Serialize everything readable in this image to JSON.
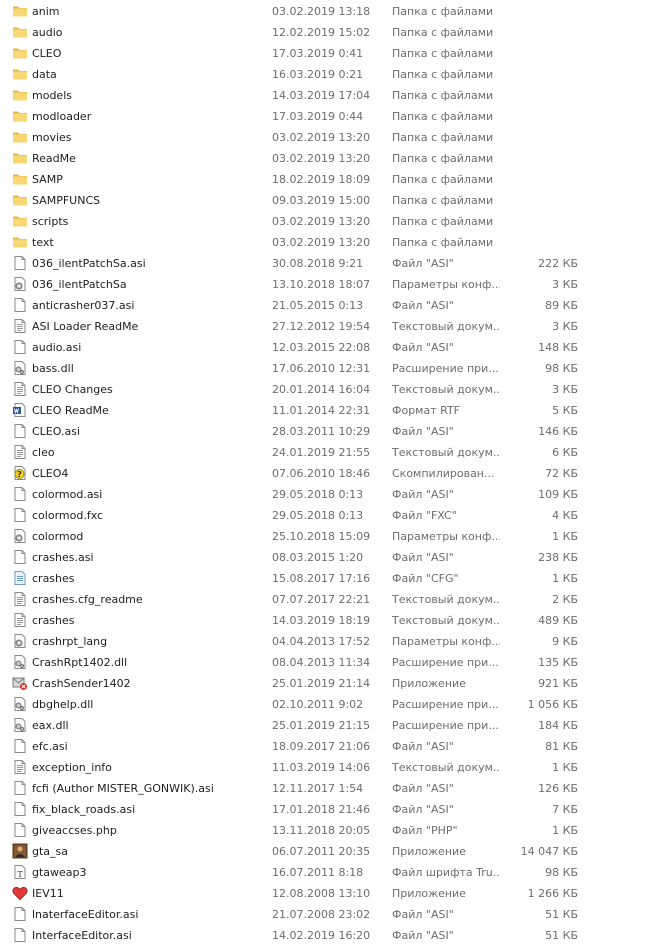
{
  "files": [
    {
      "name": "anim",
      "date": "03.02.2019 13:18",
      "type": "Папка с файлами",
      "size": "",
      "icon": "folder-icon"
    },
    {
      "name": "audio",
      "date": "12.02.2019 15:02",
      "type": "Папка с файлами",
      "size": "",
      "icon": "folder-icon"
    },
    {
      "name": "CLEO",
      "date": "17.03.2019 0:41",
      "type": "Папка с файлами",
      "size": "",
      "icon": "folder-icon"
    },
    {
      "name": "data",
      "date": "16.03.2019 0:21",
      "type": "Папка с файлами",
      "size": "",
      "icon": "folder-icon"
    },
    {
      "name": "models",
      "date": "14.03.2019 17:04",
      "type": "Папка с файлами",
      "size": "",
      "icon": "folder-icon"
    },
    {
      "name": "modloader",
      "date": "17.03.2019 0:44",
      "type": "Папка с файлами",
      "size": "",
      "icon": "folder-icon"
    },
    {
      "name": "movies",
      "date": "03.02.2019 13:20",
      "type": "Папка с файлами",
      "size": "",
      "icon": "folder-icon"
    },
    {
      "name": "ReadMe",
      "date": "03.02.2019 13:20",
      "type": "Папка с файлами",
      "size": "",
      "icon": "folder-icon"
    },
    {
      "name": "SAMP",
      "date": "18.02.2019 18:09",
      "type": "Папка с файлами",
      "size": "",
      "icon": "folder-icon"
    },
    {
      "name": "SAMPFUNCS",
      "date": "09.03.2019 15:00",
      "type": "Папка с файлами",
      "size": "",
      "icon": "folder-icon"
    },
    {
      "name": "scripts",
      "date": "03.02.2019 13:20",
      "type": "Папка с файлами",
      "size": "",
      "icon": "folder-icon"
    },
    {
      "name": "text",
      "date": "03.02.2019 13:20",
      "type": "Папка с файлами",
      "size": "",
      "icon": "folder-icon"
    },
    {
      "name": "036_ilentPatchSa.asi",
      "date": "30.08.2018 9:21",
      "type": "Файл \"ASI\"",
      "size": "222 КБ",
      "icon": "file-icon"
    },
    {
      "name": "036_ilentPatchSa",
      "date": "13.10.2018 18:07",
      "type": "Параметры конф...",
      "size": "3 КБ",
      "icon": "settings-file-icon"
    },
    {
      "name": "anticrasher037.asi",
      "date": "21.05.2015 0:13",
      "type": "Файл \"ASI\"",
      "size": "89 КБ",
      "icon": "file-icon"
    },
    {
      "name": "ASI Loader ReadMe",
      "date": "27.12.2012 19:54",
      "type": "Текстовый докум...",
      "size": "3 КБ",
      "icon": "text-file-icon"
    },
    {
      "name": "audio.asi",
      "date": "12.03.2015 22:08",
      "type": "Файл \"ASI\"",
      "size": "148 КБ",
      "icon": "file-icon"
    },
    {
      "name": "bass.dll",
      "date": "17.06.2010 12:31",
      "type": "Расширение при...",
      "size": "98 КБ",
      "icon": "dll-file-icon"
    },
    {
      "name": "CLEO Changes",
      "date": "20.01.2014 16:04",
      "type": "Текстовый докум...",
      "size": "3 КБ",
      "icon": "text-file-icon"
    },
    {
      "name": "CLEO ReadMe",
      "date": "11.01.2014 22:31",
      "type": "Формат RTF",
      "size": "5 КБ",
      "icon": "rtf-file-icon"
    },
    {
      "name": "CLEO.asi",
      "date": "28.03.2011 10:29",
      "type": "Файл \"ASI\"",
      "size": "146 КБ",
      "icon": "file-icon"
    },
    {
      "name": "cleo",
      "date": "24.01.2019 21:55",
      "type": "Текстовый докум...",
      "size": "6 КБ",
      "icon": "text-file-icon"
    },
    {
      "name": "CLEO4",
      "date": "07.06.2010 18:46",
      "type": "Скомпилирован...",
      "size": "72 КБ",
      "icon": "help-file-icon"
    },
    {
      "name": "colormod.asi",
      "date": "29.05.2018 0:13",
      "type": "Файл \"ASI\"",
      "size": "109 КБ",
      "icon": "file-icon"
    },
    {
      "name": "colormod.fxc",
      "date": "29.05.2018 0:13",
      "type": "Файл \"FXC\"",
      "size": "4 КБ",
      "icon": "file-icon"
    },
    {
      "name": "colormod",
      "date": "25.10.2018 15:09",
      "type": "Параметры конф...",
      "size": "1 КБ",
      "icon": "settings-file-icon"
    },
    {
      "name": "crashes.asi",
      "date": "08.03.2015 1:20",
      "type": "Файл \"ASI\"",
      "size": "238 КБ",
      "icon": "file-icon"
    },
    {
      "name": "crashes",
      "date": "15.08.2017 17:16",
      "type": "Файл \"CFG\"",
      "size": "1 КБ",
      "icon": "cfg-file-icon"
    },
    {
      "name": "crashes.cfg_readme",
      "date": "07.07.2017 22:21",
      "type": "Текстовый докум...",
      "size": "2 КБ",
      "icon": "text-file-icon"
    },
    {
      "name": "crashes",
      "date": "14.03.2019 18:19",
      "type": "Текстовый докум...",
      "size": "489 КБ",
      "icon": "text-file-icon"
    },
    {
      "name": "crashrpt_lang",
      "date": "04.04.2013 17:52",
      "type": "Параметры конф...",
      "size": "9 КБ",
      "icon": "settings-file-icon"
    },
    {
      "name": "CrashRpt1402.dll",
      "date": "08.04.2013 11:34",
      "type": "Расширение при...",
      "size": "135 КБ",
      "icon": "dll-file-icon"
    },
    {
      "name": "CrashSender1402",
      "date": "25.01.2019 21:14",
      "type": "Приложение",
      "size": "921 КБ",
      "icon": "crash-sender-icon"
    },
    {
      "name": "dbghelp.dll",
      "date": "02.10.2011 9:02",
      "type": "Расширение при...",
      "size": "1 056 КБ",
      "icon": "dll-file-icon"
    },
    {
      "name": "eax.dll",
      "date": "25.01.2019 21:15",
      "type": "Расширение при...",
      "size": "184 КБ",
      "icon": "dll-file-icon"
    },
    {
      "name": "efc.asi",
      "date": "18.09.2017 21:06",
      "type": "Файл \"ASI\"",
      "size": "81 КБ",
      "icon": "file-icon"
    },
    {
      "name": "exception_info",
      "date": "11.03.2019 14:06",
      "type": "Текстовый докум...",
      "size": "1 КБ",
      "icon": "text-file-icon"
    },
    {
      "name": "fcfi (Author MISTER_GONWIK).asi",
      "date": "12.11.2017 1:54",
      "type": "Файл \"ASI\"",
      "size": "126 КБ",
      "icon": "file-icon"
    },
    {
      "name": "fix_black_roads.asi",
      "date": "17.01.2018 21:46",
      "type": "Файл \"ASI\"",
      "size": "7 КБ",
      "icon": "file-icon"
    },
    {
      "name": "giveaccses.php",
      "date": "13.11.2018 20:05",
      "type": "Файл \"PHP\"",
      "size": "1 КБ",
      "icon": "file-icon"
    },
    {
      "name": "gta_sa",
      "date": "06.07.2011 20:35",
      "type": "Приложение",
      "size": "14 047 КБ",
      "icon": "gta-sa-app-icon"
    },
    {
      "name": "gtaweap3",
      "date": "16.07.2011 8:18",
      "type": "Файл шрифта Tru...",
      "size": "98 КБ",
      "icon": "font-file-icon"
    },
    {
      "name": "IEV11",
      "date": "12.08.2008 13:10",
      "type": "Приложение",
      "size": "1 266 КБ",
      "icon": "heart-app-icon"
    },
    {
      "name": "lnaterfaceEditor.asi",
      "date": "21.07.2008 23:02",
      "type": "Файл \"ASI\"",
      "size": "51 КБ",
      "icon": "file-icon"
    },
    {
      "name": "InterfaceEditor.asi",
      "date": "14.02.2019 16:20",
      "type": "Файл \"ASI\"",
      "size": "51 КБ",
      "icon": "file-icon"
    }
  ],
  "colors": {
    "folder": "#f8d775",
    "folder_dark": "#e3b64a",
    "text": "#1e1e1e",
    "muted": "#6d6d6d"
  }
}
